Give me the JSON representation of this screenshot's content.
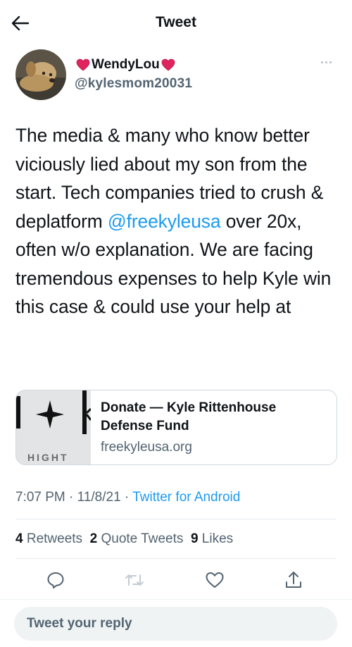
{
  "header": {
    "title": "Tweet",
    "back_icon": "arrow-left-icon"
  },
  "author": {
    "display_name": "WendyLou",
    "handle": "@kylesmom20031",
    "heart_color": "#e0245e",
    "more_icon": "more-icon"
  },
  "tweet": {
    "text_before": "The media & many who know better viciously lied about my son from the start. Tech companies tried to crush & deplatform ",
    "mention": "@freekyleusa",
    "text_after": " over 20x, often w/o explanation. We are facing tremendous expenses to help Kyle win this case & could use your help at"
  },
  "card": {
    "title": "Donate — Kyle Rittenhouse Defense Fund",
    "domain": "freekyleusa.org",
    "thumb_text": "HIGHT"
  },
  "meta": {
    "time": "7:07 PM",
    "separator": "·",
    "date": "11/8/21",
    "source": "Twitter for Android"
  },
  "stats": {
    "retweets_count": "4",
    "retweets_label": "Retweets",
    "quotes_count": "2",
    "quotes_label": "Quote Tweets",
    "likes_count": "9",
    "likes_label": "Likes"
  },
  "actions": {
    "reply_icon": "reply-icon",
    "retweet_icon": "retweet-icon",
    "like_icon": "like-icon",
    "share_icon": "share-icon"
  },
  "reply": {
    "placeholder": "Tweet your reply"
  },
  "colors": {
    "accent": "#1d9bf0",
    "secondary_text": "#536471",
    "primary_text": "#0f1419"
  }
}
